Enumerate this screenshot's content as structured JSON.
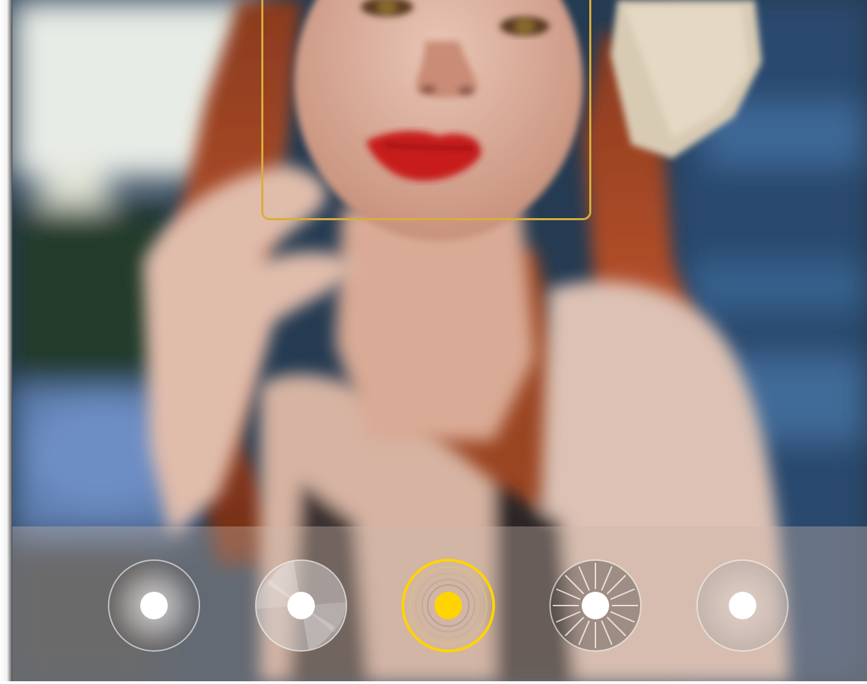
{
  "camera": {
    "face_detection_frame": {
      "visible": true,
      "color": "#d9ad3c"
    },
    "lighting_modes": {
      "selected_index": 2,
      "accent_color": "#ffd400",
      "items": [
        {
          "icon": "soft-light-icon"
        },
        {
          "icon": "butterfly-light-icon"
        },
        {
          "icon": "split-light-icon"
        },
        {
          "icon": "stage-light-icon"
        },
        {
          "icon": "classic-light-icon"
        }
      ]
    }
  }
}
